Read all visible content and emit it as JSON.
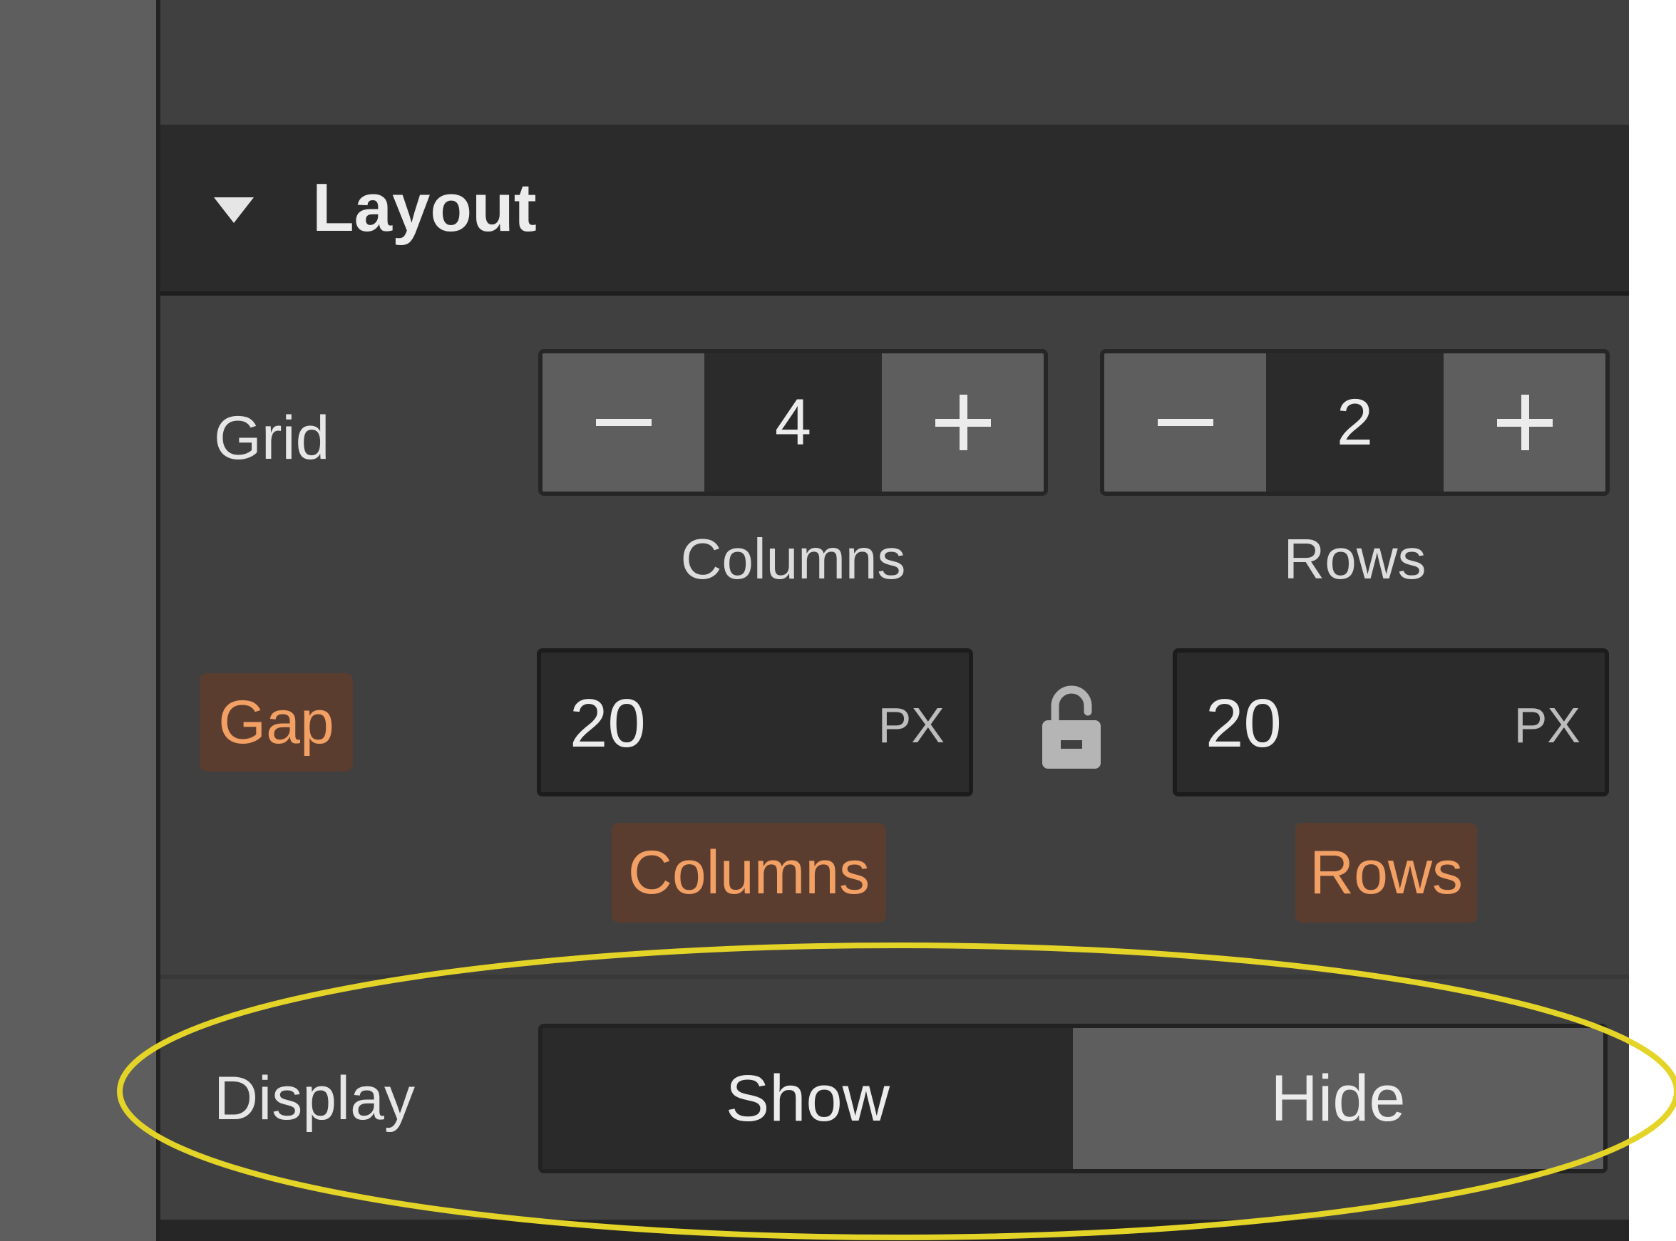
{
  "section": {
    "title": "Layout"
  },
  "grid": {
    "label": "Grid",
    "columns": {
      "value": "4",
      "label": "Columns"
    },
    "rows": {
      "value": "2",
      "label": "Rows"
    }
  },
  "gap": {
    "label": "Gap",
    "columns": {
      "value": "20",
      "unit": "PX",
      "label": "Columns"
    },
    "rows": {
      "value": "20",
      "unit": "PX",
      "label": "Rows"
    }
  },
  "display": {
    "label": "Display",
    "options": [
      "Show",
      "Hide"
    ],
    "selected": "Show"
  },
  "colors": {
    "panel": "#404040",
    "header": "#2b2b2b",
    "highlight_bg": "#5b3d30",
    "highlight_text": "#f2a064",
    "annotation": "#e5d428"
  },
  "icons": [
    "caret-down-icon",
    "minus-icon",
    "plus-icon",
    "unlock-icon"
  ]
}
